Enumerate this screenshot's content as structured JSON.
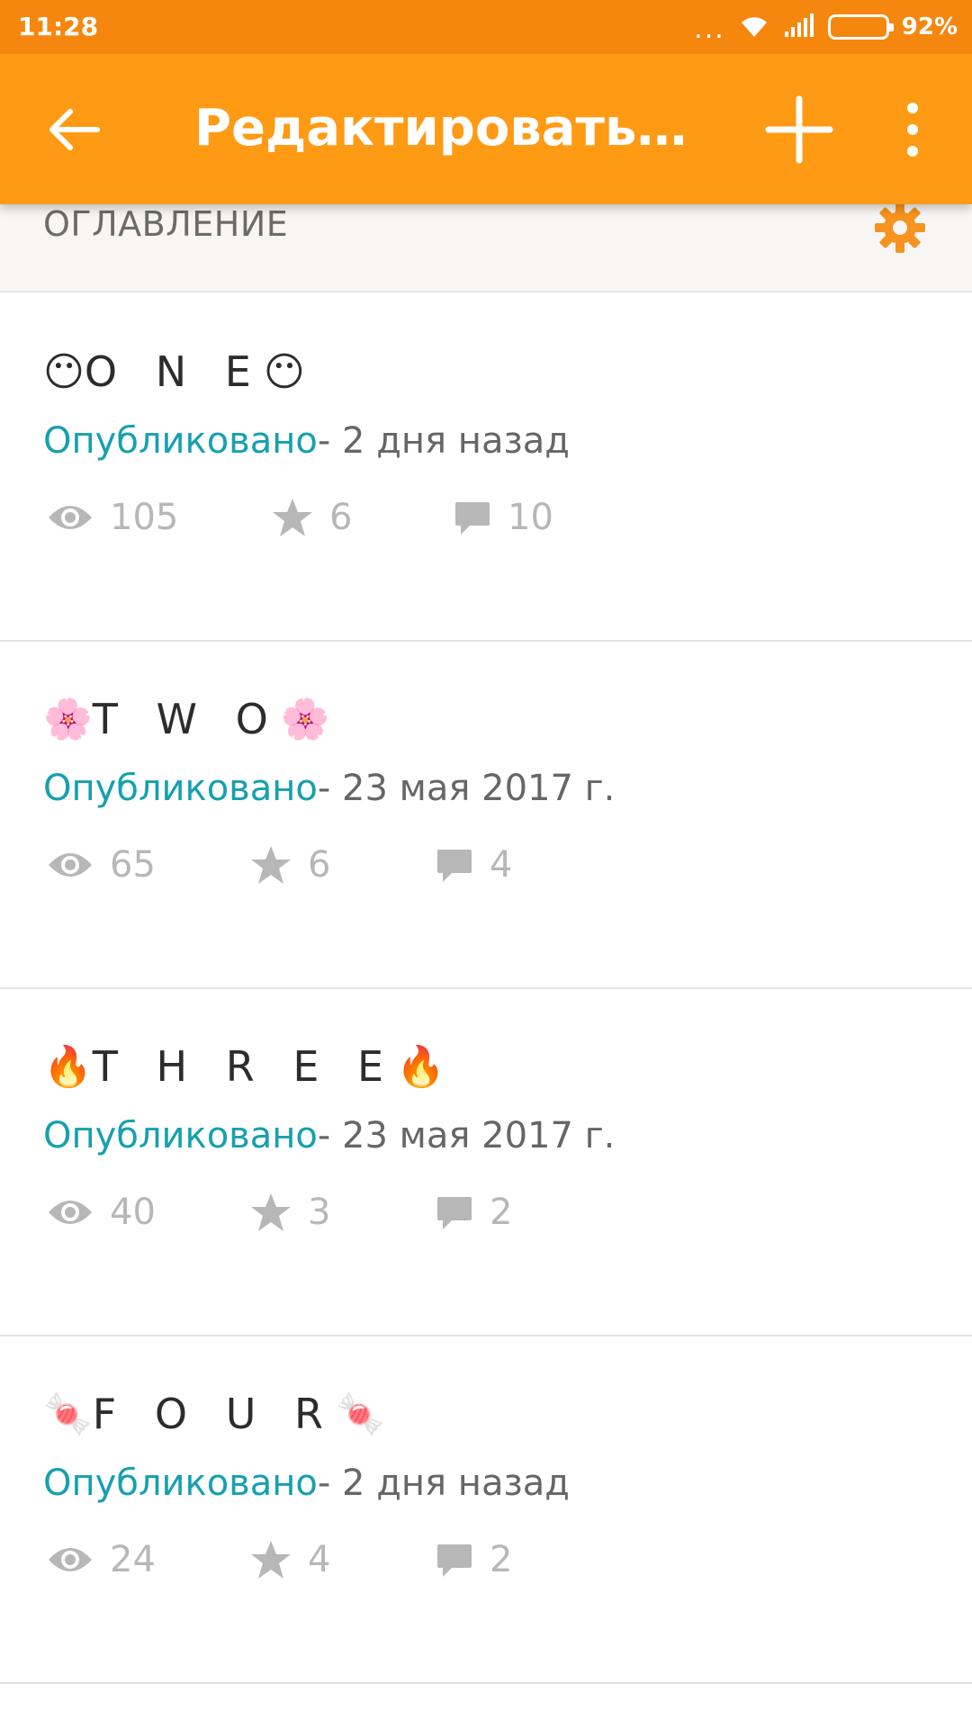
{
  "status_bar": {
    "time": "11:28",
    "dots": "...",
    "battery_percent": "92%",
    "battery_level": 0.92
  },
  "app_bar": {
    "title": "Редактировать ис...",
    "back_icon": "arrow-back-icon",
    "add_icon": "plus-icon",
    "more_icon": "more-vertical-icon"
  },
  "section": {
    "title": "ОГЛАВЛЕНИЕ",
    "settings_icon": "gear-icon"
  },
  "chapters": [
    {
      "emoji": "😶",
      "title": "O N E",
      "status": "Опубликовано",
      "date": "- 2 дня назад",
      "views": "105",
      "votes": "6",
      "comments": "10"
    },
    {
      "emoji": "🌸",
      "title": "T W O",
      "status": "Опубликовано",
      "date": "- 23 мая 2017 г.",
      "views": "65",
      "votes": "6",
      "comments": "4"
    },
    {
      "emoji": "🔥",
      "title": "T H R E E",
      "status": "Опубликовано",
      "date": "- 23 мая 2017 г.",
      "views": "40",
      "votes": "3",
      "comments": "2"
    },
    {
      "emoji": "🍬",
      "title": "F O U R",
      "status": "Опубликовано",
      "date": "- 2 дня назад",
      "views": "24",
      "votes": "4",
      "comments": "2"
    }
  ],
  "colors": {
    "status_bar": "#f5870f",
    "app_bar": "#ff9a14",
    "accent_teal": "#16a0b0",
    "stat_gray": "#b7b7b7"
  }
}
